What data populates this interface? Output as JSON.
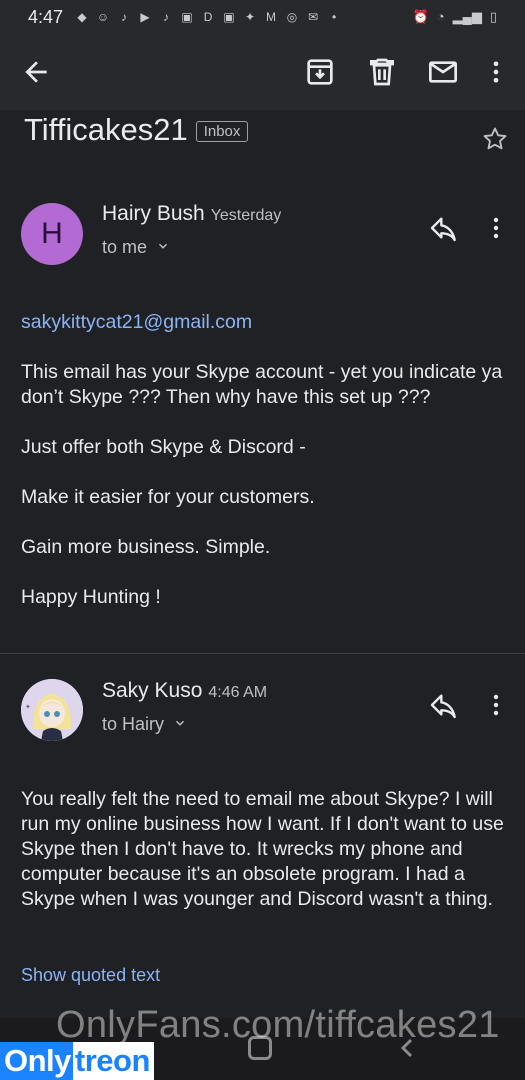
{
  "status_bar": {
    "time": "4:47",
    "notification_icons": [
      "gamepad-icon",
      "ghost-icon",
      "tiktok-icon",
      "youtube-icon",
      "tiktok-icon",
      "webtoon-icon",
      "d-app-icon",
      "webtoon-icon",
      "bird-icon",
      "gmail-icon",
      "instagram-icon",
      "outlook-icon",
      "dot-icon"
    ],
    "right_icons": [
      "alarm-icon",
      "wifi-icon",
      "signal-icon",
      "battery-icon"
    ]
  },
  "app_bar": {
    "back_icon": "arrow-back-icon",
    "actions": [
      "archive-icon",
      "delete-icon",
      "mark-unread-icon",
      "more-vert-icon"
    ]
  },
  "subject": {
    "title": "Tifficakes21",
    "label": "Inbox"
  },
  "messages": [
    {
      "avatar_letter": "H",
      "avatar_color": "#b36ad3",
      "sender": "Hairy Bush",
      "time": "Yesterday",
      "to": "to me",
      "email_link": "sakykittycat21@gmail.com",
      "paragraphs": [
        "This email has your Skype account - yet you indicate ya don’t Skype ???  Then why have this set up ???",
        "Just offer both Skype & Discord -",
        "Make it easier for your customers.",
        "Gain more business.  Simple.",
        "Happy Hunting !"
      ]
    },
    {
      "sender": "Saky Kuso",
      "time": "4:46 AM",
      "to": "to Hairy",
      "paragraphs": [
        "You really felt the need to email me about Skype? I will run my online business how I want. If I don't want to use Skype then I don't have to. It wrecks my phone and computer because it's an obsolete program. I had a Skype when I was younger and Discord wasn't a thing."
      ],
      "show_quoted": "Show quoted text"
    }
  ],
  "watermark": "OnlyFans.com/tiffcakes21",
  "brand": {
    "part1": "Only",
    "part2": "treon"
  },
  "colors": {
    "background": "#202124",
    "link": "#8ab4f8",
    "brand_blue": "#1b83ff"
  }
}
